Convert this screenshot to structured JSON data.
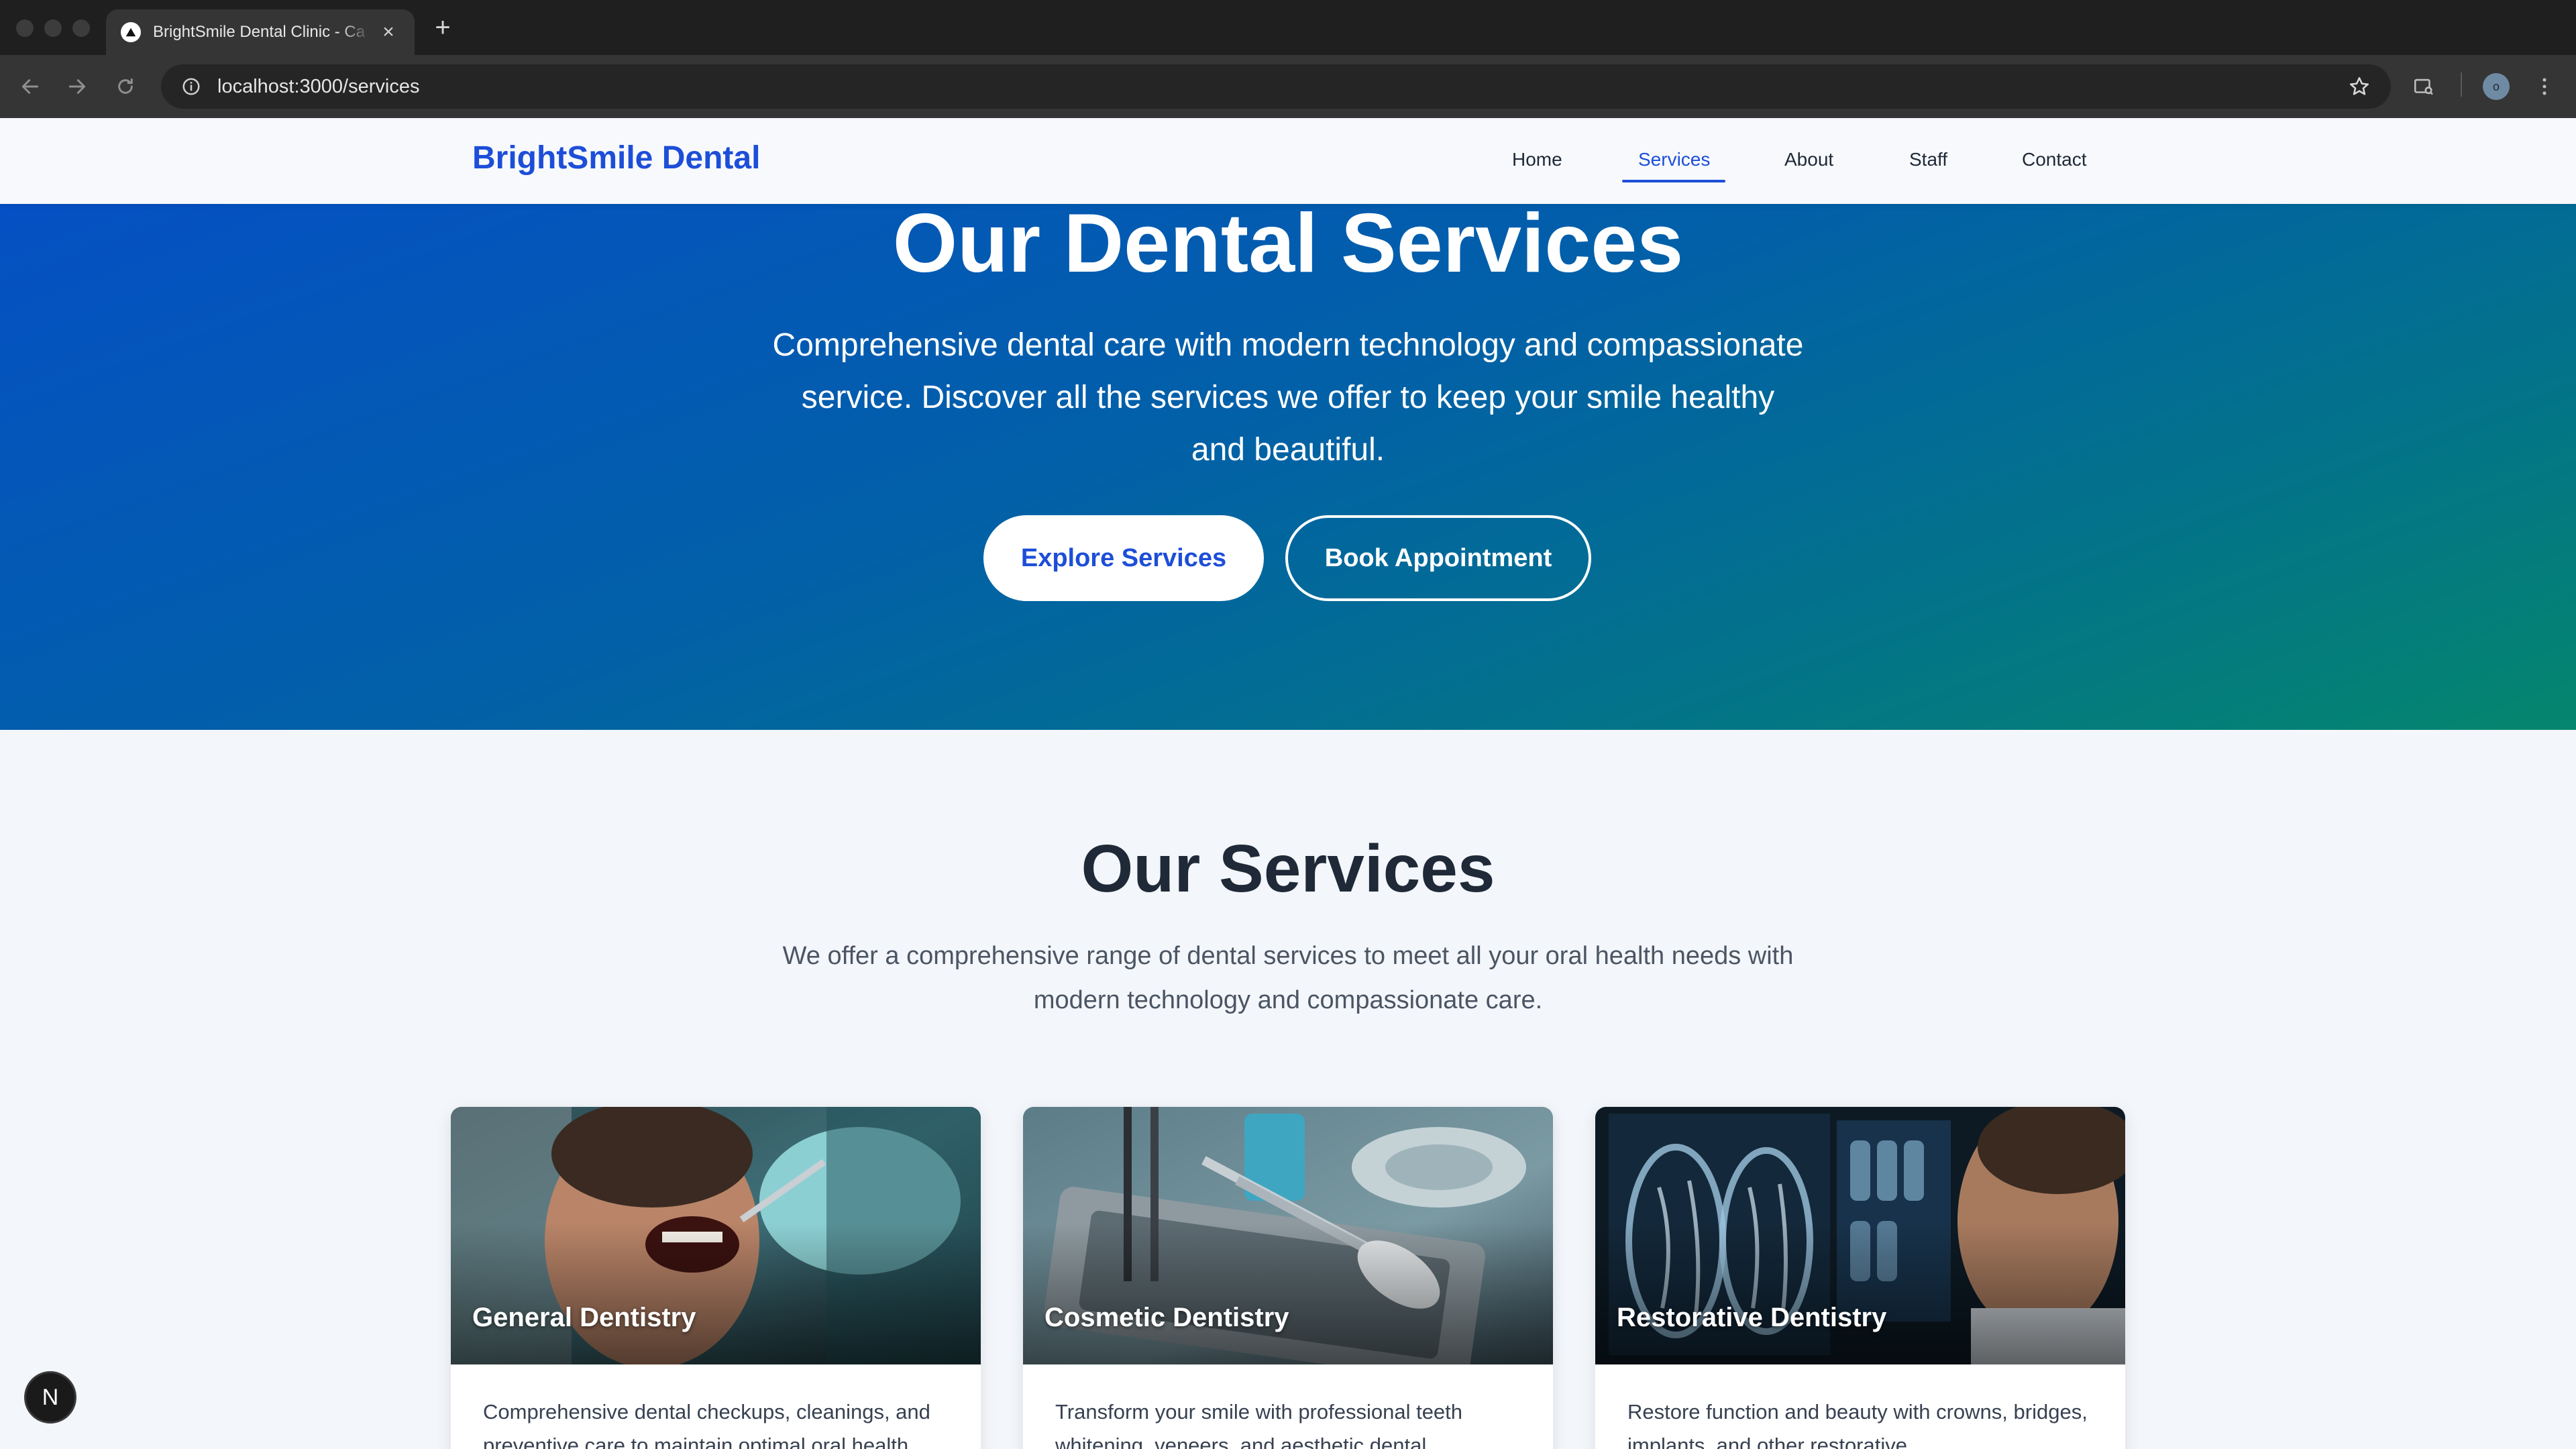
{
  "browser": {
    "tab_title": "BrightSmile Dental Clinic - Ca",
    "tab_close": "×",
    "new_tab": "+",
    "url": "localhost:3000/services",
    "profile_initial": "o"
  },
  "site": {
    "logo": "BrightSmile Dental",
    "nav": [
      "Home",
      "Services",
      "About",
      "Staff",
      "Contact"
    ],
    "active_nav": "Services"
  },
  "hero": {
    "title": "Our Dental Services",
    "subtitle": "Comprehensive dental care with modern technology and compassionate service. Discover all the services we offer to keep your smile healthy and beautiful.",
    "primary_button": "Explore Services",
    "secondary_button": "Book Appointment"
  },
  "services": {
    "title": "Our Services",
    "subtitle": "We offer a comprehensive range of dental services to meet all your oral health needs with modern technology and compassionate care.",
    "cards": [
      {
        "title": "General Dentistry",
        "description": "Comprehensive dental checkups, cleanings, and preventive care to maintain optimal oral health."
      },
      {
        "title": "Cosmetic Dentistry",
        "description": "Transform your smile with professional teeth whitening, veneers, and aesthetic dental"
      },
      {
        "title": "Restorative Dentistry",
        "description": "Restore function and beauty with crowns, bridges, implants, and other restorative"
      }
    ]
  },
  "dev_badge": "N",
  "colors": {
    "brand_blue": "#1d4ed8",
    "hero_gradient_start": "#0550c4",
    "hero_gradient_end": "#05866e",
    "text_dark": "#1f2937"
  }
}
